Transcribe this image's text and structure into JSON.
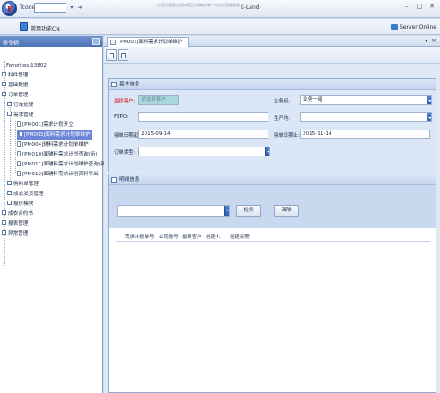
{
  "titlebar": {
    "tcode_label": "Tcode",
    "tcode_value": "",
    "center_text": "以项目管理应用和规范为基础的新一代商业智能管理",
    "app_name": "E-Land"
  },
  "menubar": {
    "favorite_label": "常用功能CN",
    "server_status": "Server Online"
  },
  "sidebar": {
    "header": "命令树",
    "favorites": "Favorites:13802",
    "items": [
      {
        "label": "科件管理"
      },
      {
        "label": "基础数据"
      },
      {
        "label": "订单管理"
      },
      {
        "label": "订单处理"
      },
      {
        "label": "需求管理"
      },
      {
        "label": "[PM001]需求计划开立"
      },
      {
        "label": "[PM003]面料需求计划单维护"
      },
      {
        "label": "[PM004]辅料需求计划单维护"
      },
      {
        "label": "[PM010]面辅料需求计划查询(新)"
      },
      {
        "label": "[PM011]面辅料需求计划维护查询(新)"
      },
      {
        "label": "[PM012]面辅料需求计划资料导出"
      },
      {
        "label": "购料单管理"
      },
      {
        "label": "成衣发货管理"
      },
      {
        "label": "报价模块"
      },
      {
        "label": "成衣合约书"
      },
      {
        "label": "报表管理"
      },
      {
        "label": "异常管理"
      }
    ]
  },
  "tab": {
    "label": "[PM003]面料需求计划单维护"
  },
  "basic_info": {
    "title": "基本信息",
    "final_customer_label": "最终客户:",
    "final_customer_value": "请选择客户",
    "business_group_label": "业务组:",
    "business_group_value": "业务一组",
    "fepo_label": "FEPO:",
    "fepo_value": "",
    "production_site_label": "生产地:",
    "production_site_value": "",
    "start_date_label": "接单日期起:",
    "start_date_value": "2015-09-14",
    "end_date_label": "接单日期止:",
    "end_date_value": "2015-11-14",
    "order_type_label": "订单类型:",
    "order_type_value": ""
  },
  "detail_info": {
    "title": "明细信息",
    "search_value": "",
    "search_button": "检索",
    "clear_button": "清除",
    "columns": [
      "需求计划单号",
      "公司款号",
      "最终客户",
      "创建人",
      "创建日期"
    ]
  }
}
